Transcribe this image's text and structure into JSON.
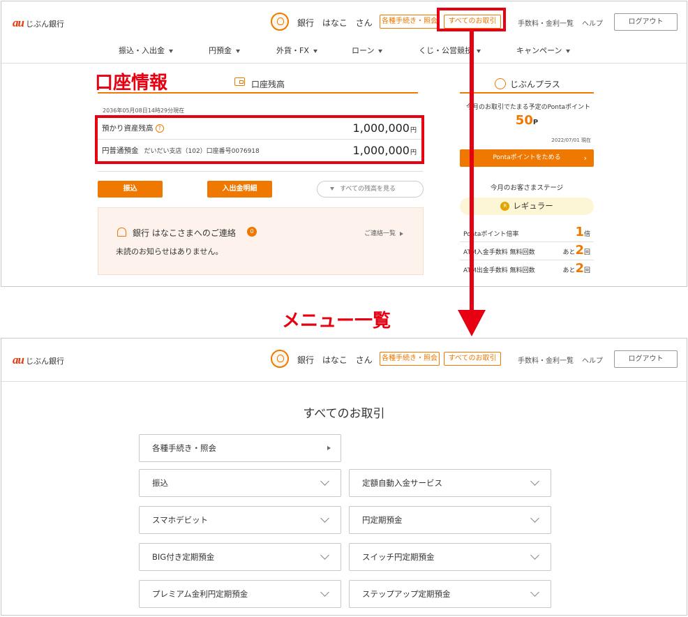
{
  "colors": {
    "accent": "#ee7800",
    "annotation": "#e60012"
  },
  "header": {
    "logo_au": "au",
    "logo_bank": "じぶん銀行",
    "username": "銀行 はなこ さん",
    "procedures_btn": "各種手続き・照会",
    "all_transactions_btn": "すべてのお取引",
    "fees_link": "手数料・金利一覧",
    "help_link": "ヘルプ",
    "logout_btn": "ログアウト"
  },
  "nav": {
    "items": [
      {
        "label": "振込・入出金"
      },
      {
        "label": "円預金"
      },
      {
        "label": "外貨・FX"
      },
      {
        "label": "ローン"
      },
      {
        "label": "くじ・公営競技"
      },
      {
        "label": "キャンペーン"
      }
    ]
  },
  "annotations": {
    "account_info": "口座情報",
    "menu_list": "メニュー一覧"
  },
  "account": {
    "tab_title": "口座残高",
    "as_of": "2036年05月08日14時29分現在",
    "total_label": "預かり資産残高",
    "total_amount": "1,000,000",
    "yen": "円",
    "savings_label": "円普通預金",
    "branch": "だいだい支店（102）口座番号0076918",
    "savings_amount": "1,000,000",
    "transfer_btn": "振込",
    "statement_btn": "入出金明細",
    "all_balance_btn": "すべての残高を見る"
  },
  "notice": {
    "title": "銀行 はなこさまへのご連絡",
    "count": "0",
    "link": "ご連絡一覧",
    "body": "未読のお知らせはありません。"
  },
  "jibun_plus": {
    "title": "じぶんプラス",
    "caption": "今月のお取引でたまる予定のPontaポイント",
    "points": "50",
    "points_unit": "P",
    "date": "2022/07/01 現在",
    "ponta_btn": "Pontaポイントをためる",
    "stage_caption": "今月のお客さまステージ",
    "stage": "レギュラー",
    "stage_medal": "R",
    "rows": [
      {
        "label": "Pontaポイント倍率",
        "prefix": "",
        "value": "1",
        "suffix": "倍"
      },
      {
        "label": "ATM入金手数料 無料回数",
        "prefix": "あと",
        "value": "2",
        "suffix": "回"
      },
      {
        "label": "ATM出金手数料 無料回数",
        "prefix": "あと",
        "value": "2",
        "suffix": "回"
      }
    ]
  },
  "menu": {
    "title": "すべてのお取引",
    "procedures": "各種手続き・照会",
    "items": [
      {
        "label": "振込"
      },
      {
        "label": "定額自動入金サービス"
      },
      {
        "label": "スマホデビット"
      },
      {
        "label": "円定期預金"
      },
      {
        "label": "BIG付き定期預金"
      },
      {
        "label": "スイッチ円定期預金"
      },
      {
        "label": "プレミアム金利円定期預金"
      },
      {
        "label": "ステップアップ定期預金"
      }
    ]
  }
}
